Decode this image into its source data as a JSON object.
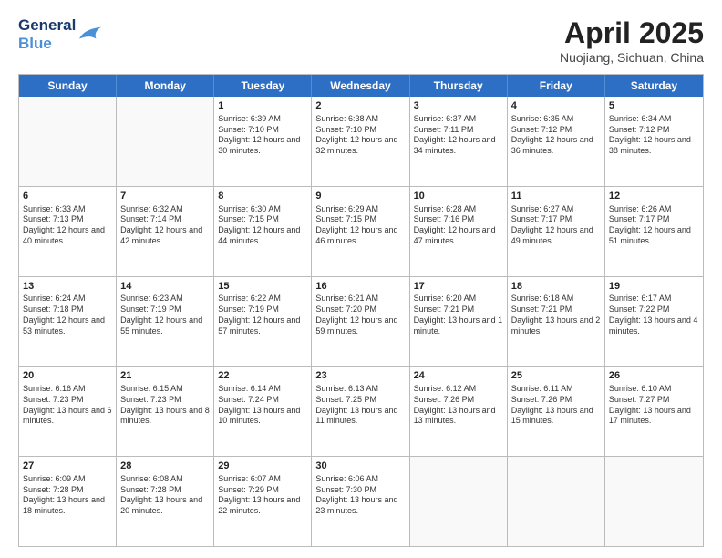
{
  "logo": {
    "line1": "General",
    "line2": "Blue"
  },
  "title": {
    "month_year": "April 2025",
    "location": "Nuojiang, Sichuan, China"
  },
  "days_of_week": [
    "Sunday",
    "Monday",
    "Tuesday",
    "Wednesday",
    "Thursday",
    "Friday",
    "Saturday"
  ],
  "rows": [
    [
      {
        "day": "",
        "info": ""
      },
      {
        "day": "",
        "info": ""
      },
      {
        "day": "1",
        "info": "Sunrise: 6:39 AM\nSunset: 7:10 PM\nDaylight: 12 hours and 30 minutes."
      },
      {
        "day": "2",
        "info": "Sunrise: 6:38 AM\nSunset: 7:10 PM\nDaylight: 12 hours and 32 minutes."
      },
      {
        "day": "3",
        "info": "Sunrise: 6:37 AM\nSunset: 7:11 PM\nDaylight: 12 hours and 34 minutes."
      },
      {
        "day": "4",
        "info": "Sunrise: 6:35 AM\nSunset: 7:12 PM\nDaylight: 12 hours and 36 minutes."
      },
      {
        "day": "5",
        "info": "Sunrise: 6:34 AM\nSunset: 7:12 PM\nDaylight: 12 hours and 38 minutes."
      }
    ],
    [
      {
        "day": "6",
        "info": "Sunrise: 6:33 AM\nSunset: 7:13 PM\nDaylight: 12 hours and 40 minutes."
      },
      {
        "day": "7",
        "info": "Sunrise: 6:32 AM\nSunset: 7:14 PM\nDaylight: 12 hours and 42 minutes."
      },
      {
        "day": "8",
        "info": "Sunrise: 6:30 AM\nSunset: 7:15 PM\nDaylight: 12 hours and 44 minutes."
      },
      {
        "day": "9",
        "info": "Sunrise: 6:29 AM\nSunset: 7:15 PM\nDaylight: 12 hours and 46 minutes."
      },
      {
        "day": "10",
        "info": "Sunrise: 6:28 AM\nSunset: 7:16 PM\nDaylight: 12 hours and 47 minutes."
      },
      {
        "day": "11",
        "info": "Sunrise: 6:27 AM\nSunset: 7:17 PM\nDaylight: 12 hours and 49 minutes."
      },
      {
        "day": "12",
        "info": "Sunrise: 6:26 AM\nSunset: 7:17 PM\nDaylight: 12 hours and 51 minutes."
      }
    ],
    [
      {
        "day": "13",
        "info": "Sunrise: 6:24 AM\nSunset: 7:18 PM\nDaylight: 12 hours and 53 minutes."
      },
      {
        "day": "14",
        "info": "Sunrise: 6:23 AM\nSunset: 7:19 PM\nDaylight: 12 hours and 55 minutes."
      },
      {
        "day": "15",
        "info": "Sunrise: 6:22 AM\nSunset: 7:19 PM\nDaylight: 12 hours and 57 minutes."
      },
      {
        "day": "16",
        "info": "Sunrise: 6:21 AM\nSunset: 7:20 PM\nDaylight: 12 hours and 59 minutes."
      },
      {
        "day": "17",
        "info": "Sunrise: 6:20 AM\nSunset: 7:21 PM\nDaylight: 13 hours and 1 minute."
      },
      {
        "day": "18",
        "info": "Sunrise: 6:18 AM\nSunset: 7:21 PM\nDaylight: 13 hours and 2 minutes."
      },
      {
        "day": "19",
        "info": "Sunrise: 6:17 AM\nSunset: 7:22 PM\nDaylight: 13 hours and 4 minutes."
      }
    ],
    [
      {
        "day": "20",
        "info": "Sunrise: 6:16 AM\nSunset: 7:23 PM\nDaylight: 13 hours and 6 minutes."
      },
      {
        "day": "21",
        "info": "Sunrise: 6:15 AM\nSunset: 7:23 PM\nDaylight: 13 hours and 8 minutes."
      },
      {
        "day": "22",
        "info": "Sunrise: 6:14 AM\nSunset: 7:24 PM\nDaylight: 13 hours and 10 minutes."
      },
      {
        "day": "23",
        "info": "Sunrise: 6:13 AM\nSunset: 7:25 PM\nDaylight: 13 hours and 11 minutes."
      },
      {
        "day": "24",
        "info": "Sunrise: 6:12 AM\nSunset: 7:26 PM\nDaylight: 13 hours and 13 minutes."
      },
      {
        "day": "25",
        "info": "Sunrise: 6:11 AM\nSunset: 7:26 PM\nDaylight: 13 hours and 15 minutes."
      },
      {
        "day": "26",
        "info": "Sunrise: 6:10 AM\nSunset: 7:27 PM\nDaylight: 13 hours and 17 minutes."
      }
    ],
    [
      {
        "day": "27",
        "info": "Sunrise: 6:09 AM\nSunset: 7:28 PM\nDaylight: 13 hours and 18 minutes."
      },
      {
        "day": "28",
        "info": "Sunrise: 6:08 AM\nSunset: 7:28 PM\nDaylight: 13 hours and 20 minutes."
      },
      {
        "day": "29",
        "info": "Sunrise: 6:07 AM\nSunset: 7:29 PM\nDaylight: 13 hours and 22 minutes."
      },
      {
        "day": "30",
        "info": "Sunrise: 6:06 AM\nSunset: 7:30 PM\nDaylight: 13 hours and 23 minutes."
      },
      {
        "day": "",
        "info": ""
      },
      {
        "day": "",
        "info": ""
      },
      {
        "day": "",
        "info": ""
      }
    ]
  ]
}
